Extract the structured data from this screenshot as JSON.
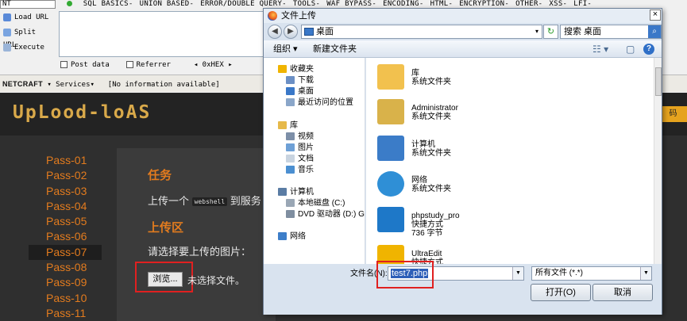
{
  "hackbar": {
    "select_value": "NT",
    "menus": [
      "SQL BASICS-",
      "UNION BASED-",
      "ERROR/DOUBLE QUERY-",
      "TOOLS-",
      "WAF BYPASS-",
      "ENCODING-",
      "HTML-",
      "ENCRYPTION-",
      "OTHER-",
      "XSS-",
      "LFI-"
    ],
    "load_url": "Load URL",
    "split_url": "Split URL",
    "execute": "Execute",
    "post_data": "Post data",
    "referrer": "Referrer",
    "hex_label": "0xHEX"
  },
  "netcraft": {
    "logo": "NETCRAFT",
    "services": "Services",
    "info": "[No information available]"
  },
  "page": {
    "logo": "UpLood-loAS",
    "right_button": "码",
    "passes": [
      "Pass-01",
      "Pass-02",
      "Pass-03",
      "Pass-04",
      "Pass-05",
      "Pass-06",
      "Pass-07",
      "Pass-08",
      "Pass-09",
      "Pass-10",
      "Pass-11"
    ],
    "active_pass": "Pass-07",
    "task_heading": "任务",
    "task_text_a": "上传一个",
    "task_code": "webshell",
    "task_text_b": "到服务",
    "upload_heading": "上传区",
    "upload_text": "请选择要上传的图片：",
    "browse_label": "浏览...",
    "no_file": "未选择文件。"
  },
  "dialog": {
    "title": "文件上传",
    "close": "×",
    "address": "桌面",
    "search_placeholder": "搜索 桌面",
    "toolbar_organize": "组织 ▾",
    "toolbar_new_folder": "新建文件夹",
    "tree": [
      {
        "label": "收藏夹",
        "icon": "star-icon",
        "color": "#f0b400"
      },
      {
        "label": "下载",
        "icon": "download-folder-icon",
        "color": "#6b8fc5"
      },
      {
        "label": "桌面",
        "icon": "desktop-icon",
        "color": "#3a78c8"
      },
      {
        "label": "最近访问的位置",
        "icon": "recent-icon",
        "color": "#8aa6c9"
      },
      {
        "label": "库",
        "icon": "library-icon",
        "color": "#e6b94a"
      },
      {
        "label": "视频",
        "icon": "video-icon",
        "color": "#7d8fa8"
      },
      {
        "label": "图片",
        "icon": "pictures-icon",
        "color": "#6ea0d6"
      },
      {
        "label": "文档",
        "icon": "documents-icon",
        "color": "#c9d4e0"
      },
      {
        "label": "音乐",
        "icon": "music-icon",
        "color": "#4b8fd1"
      },
      {
        "label": "计算机",
        "icon": "computer-icon",
        "color": "#5a7ca4"
      },
      {
        "label": "本地磁盘 (C:)",
        "icon": "disk-icon",
        "color": "#9aa7b5"
      },
      {
        "label": "DVD 驱动器 (D:) GF",
        "icon": "dvd-icon",
        "color": "#7f8ea0"
      },
      {
        "label": "网络",
        "icon": "network-icon",
        "color": "#3d7ec9"
      }
    ],
    "files": [
      {
        "name": "库",
        "type": "系统文件夹",
        "icon": "library-folder-icon",
        "color": "#f2c14e"
      },
      {
        "name": "Administrator",
        "type": "系统文件夹",
        "icon": "user-folder-icon",
        "color": "#d9b24a"
      },
      {
        "name": "计算机",
        "type": "系统文件夹",
        "icon": "computer-icon",
        "color": "#3b7cc8"
      },
      {
        "name": "网络",
        "type": "系统文件夹",
        "icon": "network-globe-icon",
        "color": "#2f8fd6"
      },
      {
        "name": "phpstudy_pro",
        "type": "快捷方式",
        "size": "736 字节",
        "icon": "phpstudy-icon",
        "color": "#1e78c8"
      },
      {
        "name": "UltraEdit",
        "type": "快捷方式",
        "icon": "ultraedit-icon",
        "color": "#f0b400"
      }
    ],
    "filename_label": "文件名(N):",
    "filename_value": "test7.php",
    "filetype": "所有文件 (*.*)",
    "open_button": "打开(O)",
    "cancel_button": "取消"
  }
}
